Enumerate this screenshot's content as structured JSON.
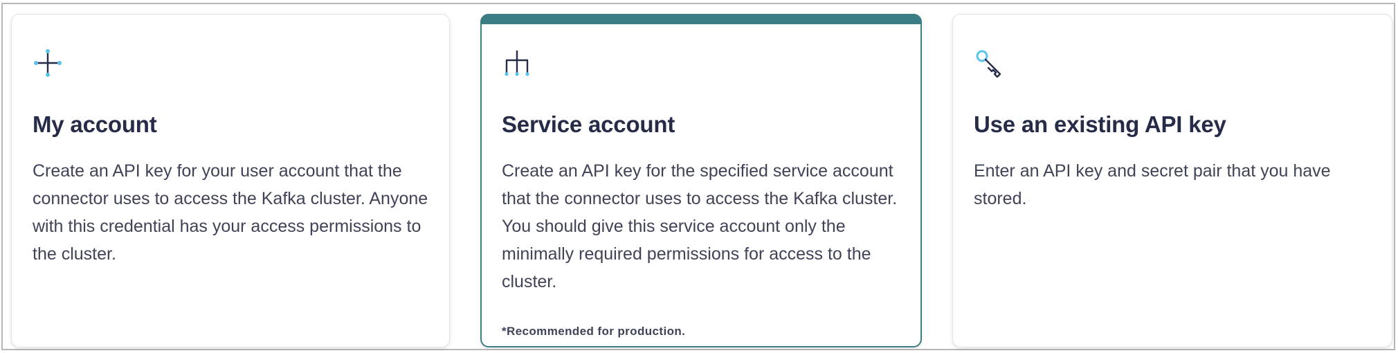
{
  "options": [
    {
      "title": "My account",
      "description": "Create an API key for your user account that the connector uses to access the Kafka cluster. Anyone with this credential has your access permissions to the cluster.",
      "icon": "plus-icon",
      "selected": false
    },
    {
      "title": "Service account",
      "description": "Create an API key for the specified service account that the connector uses to access the Kafka cluster. You should give this service account only the minimally required permissions for access to the cluster.",
      "note": "*Recommended for production.",
      "icon": "hierarchy-icon",
      "selected": true
    },
    {
      "title": "Use an existing API key",
      "description": "Enter an API key and secret pair that you have stored.",
      "icon": "key-icon",
      "selected": false
    }
  ],
  "colors": {
    "accent": "#3b7d84",
    "title": "#262b48",
    "text": "#3f4358",
    "icon_highlight": "#5bc2e7"
  }
}
